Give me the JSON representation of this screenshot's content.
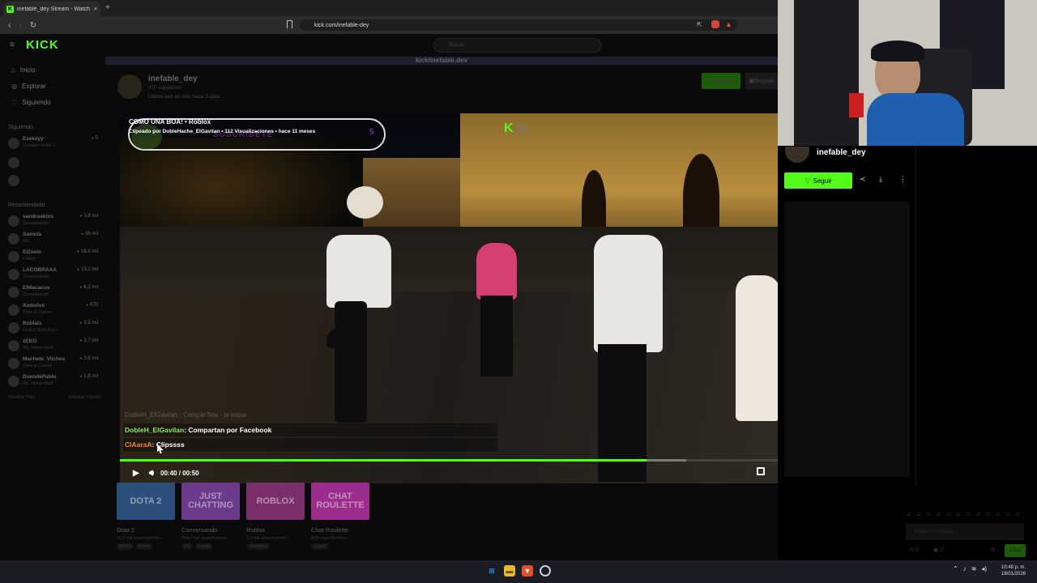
{
  "browser": {
    "tab_title": "inefable_dey Stream - Watch Li...",
    "tab_close": "×",
    "new_tab": "+",
    "url": "kick.com/inefable-dey",
    "nav_back": "‹",
    "nav_forward": "›",
    "reload": "↻"
  },
  "site": {
    "logo": "KICK",
    "search_placeholder": "Buscar",
    "nav": [
      {
        "icon": "home-icon",
        "label": "Inicio"
      },
      {
        "icon": "compass-icon",
        "label": "Explorar"
      },
      {
        "icon": "heart-icon",
        "label": "Siguiendo"
      }
    ],
    "following_header": "Siguiendo",
    "following": [
      {
        "name": "Ezekeyy",
        "category": "Counter-Strike 2",
        "viewers": "5"
      }
    ],
    "recommended_header": "Recomendado",
    "recommended": [
      {
        "name": "sandraskins",
        "category": "Conversando",
        "viewers": "3,8 mil"
      },
      {
        "name": "Samula",
        "category": "IRL",
        "viewers": "36 mil"
      },
      {
        "name": "ElZeein",
        "category": "Fútbol",
        "viewers": "16,8 mil"
      },
      {
        "name": "LACOBRAAA",
        "category": "Conversando",
        "viewers": "13,1 mil"
      },
      {
        "name": "ElMacacus",
        "category": "Conversando",
        "viewers": "6,1 mil"
      },
      {
        "name": "Xodolive",
        "category": "Slots & Casino",
        "viewers": "670"
      },
      {
        "name": "Roblais",
        "category": "Grand Theft Auto",
        "viewers": "3,5 mil"
      },
      {
        "name": "zEKO",
        "category": "IRL Tiktok Stuff",
        "viewers": "2,7 mil"
      },
      {
        "name": "Machete_Vilches",
        "category": "Slots & Casino",
        "viewers": "3,6 mil"
      },
      {
        "name": "DuendePablo",
        "category": "IRL Tiktok Stuff",
        "viewers": "1,8 mil"
      }
    ],
    "show_all": "Mostrar más",
    "show_less": "Mostrar Menos"
  },
  "channel": {
    "banner_text": "kick/inefable.dev",
    "name": "inefable_dey",
    "followers": "420 seguidores",
    "last_live": "Última vez en vivo hace 5 días",
    "follow_label": "Seguir",
    "gift_label": "Regalar"
  },
  "clip": {
    "title": "COMO UNA BOA! • Roblox",
    "info": "Clipeado por DobleHache_ElGavilan • 112 Visualizaciones • hace 11 meses",
    "overlay_subscribe": "SUSCRÍBETE",
    "overlay_number": "5",
    "watermark_logo": "K",
    "watermark_number": "21",
    "chat_ghost": "DobleH_ElGavilan : CompárTela · la toque",
    "chat": [
      {
        "user": "DobleH_ElGavilan",
        "user_color": "#8fe36a",
        "message": " : Compartan por Facebook"
      },
      {
        "user": "ClAaraA",
        "user_color": "#f08a2a",
        "message": " : Clipssss"
      }
    ],
    "time": "00:40 / 00:50",
    "progress": 0.8,
    "buffered": 0.86
  },
  "categories": [
    {
      "name": "Dota 2",
      "viewers": "20,7 mil espectadores",
      "tags": [
        "MOBA",
        "Action"
      ],
      "label": "DOTA 2",
      "color": "#2b4f7a"
    },
    {
      "name": "Conversando",
      "viewers": "504,7 mil espectadores",
      "tags": [
        "IRL",
        "Casual"
      ],
      "label": "JUST CHATTING",
      "color": "#6b3a8a"
    },
    {
      "name": "Roblox",
      "viewers": "1,7 mil espectadores",
      "tags": [
        "Simulation"
      ],
      "label": "ROBLOX",
      "color": "#7a2f6c"
    },
    {
      "name": "Chat Roulette",
      "viewers": "408 espectadores",
      "tags": [
        "Casual"
      ],
      "label": "CHAT ROULETTE",
      "color": "#9b2e8d"
    }
  ],
  "right_panel": {
    "name": "inefable_dey",
    "follow_label": "Seguir",
    "chat_placeholder": "Enviar un mensaje",
    "chat_button": "Chat",
    "stat1": "0",
    "stat2": "0"
  },
  "taskbar": {
    "time": "10:48 p. m.",
    "date": "18/01/2026"
  },
  "colors": {
    "kick_green": "#53fc18"
  }
}
